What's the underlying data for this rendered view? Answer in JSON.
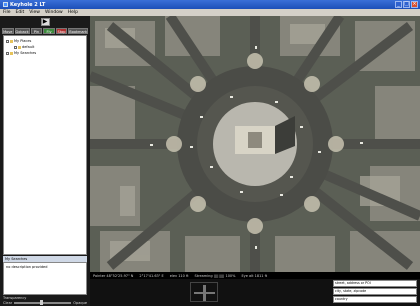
{
  "window": {
    "title": "Keyhole 2 LT"
  },
  "menu": [
    "File",
    "Edit",
    "View",
    "Window",
    "Help"
  ],
  "left": {
    "play_label": "▶",
    "toolbar": [
      {
        "label": "Move",
        "style": "gray"
      },
      {
        "label": "Goback",
        "style": "gray"
      },
      {
        "label": "Pin",
        "style": "gray"
      },
      {
        "label": "Fly",
        "style": "green"
      },
      {
        "label": "Stop",
        "style": "red"
      },
      {
        "label": "Bookmark",
        "style": "gray"
      }
    ],
    "places": [
      {
        "label": "My Places",
        "indent": false
      },
      {
        "label": "default",
        "indent": true
      },
      {
        "label": "My Searches",
        "indent": false
      }
    ],
    "search_header": "My Searches",
    "search_body": "no description provided",
    "transparency": {
      "title": "Transparency",
      "left": "Clear",
      "right": "Opaque",
      "level": 0.45
    }
  },
  "status": {
    "lat": "Pointer  48°52'25.97\" N",
    "lon": "2°17'41.63\" E",
    "alt": "elev  110 ft",
    "streaming": "Streaming ||||||||| 100%",
    "eye": "Eye alt  1811 ft"
  },
  "bottom": {
    "search_fields": [
      "street, address or POI",
      "city, state, zipcode",
      "country"
    ]
  },
  "colors": {
    "title_bar": "#1c4fb8",
    "map_base": "#6a6e62"
  }
}
